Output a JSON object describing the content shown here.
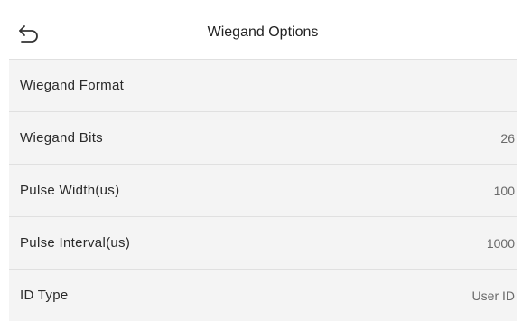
{
  "header": {
    "title": "Wiegand Options",
    "back_icon": "back-arrow-icon"
  },
  "options": [
    {
      "label": "Wiegand Format",
      "value": ""
    },
    {
      "label": "Wiegand Bits",
      "value": "26"
    },
    {
      "label": "Pulse Width(us)",
      "value": "100"
    },
    {
      "label": "Pulse Interval(us)",
      "value": "1000"
    },
    {
      "label": "ID Type",
      "value": "User ID"
    }
  ],
  "colors": {
    "header_background": "#ffffff",
    "row_background": "#f4f4f4",
    "divider": "#e0e0e0",
    "label_text": "#2a2a2a",
    "value_text": "#6a6a6a"
  }
}
